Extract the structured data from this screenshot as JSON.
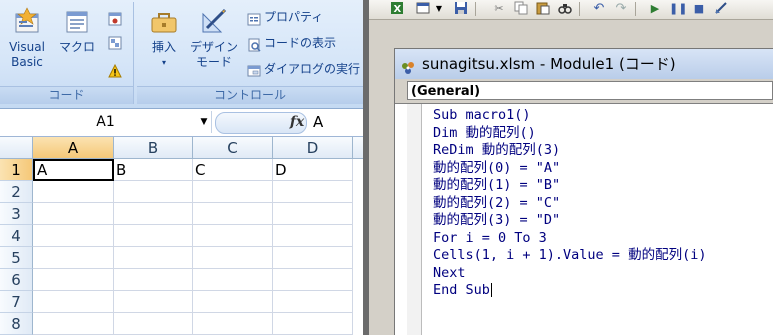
{
  "ribbon": {
    "code_group": {
      "label": "コード",
      "visual_basic": [
        "Visual",
        "Basic"
      ],
      "macro": "マクロ"
    },
    "controls_group": {
      "label": "コントロール",
      "insert": "挿入",
      "design_mode": [
        "デザイン",
        "モード"
      ],
      "properties": "プロパティ",
      "view_code": "コードの表示",
      "run_dialog": "ダイアログの実行"
    }
  },
  "formula_bar": {
    "name_box": "A1",
    "fx": "fx",
    "value": "A"
  },
  "sheet": {
    "columns": [
      "A",
      "B",
      "C",
      "D"
    ],
    "rows": [
      "1",
      "2",
      "3",
      "4",
      "5",
      "6",
      "7",
      "8"
    ],
    "cells": {
      "A1": "A",
      "B1": "B",
      "C1": "C",
      "D1": "D"
    }
  },
  "vbe": {
    "window_title": "sunagitsu.xlsm - Module1 (コード)",
    "object_combo": "(General)",
    "code": [
      "Sub macro1()",
      "Dim 動的配列()",
      "ReDim 動的配列(3)",
      "動的配列(0) = \"A\"",
      "動的配列(1) = \"B\"",
      "動的配列(2) = \"C\"",
      "動的配列(3) = \"D\"",
      "For i = 0 To 3",
      "Cells(1, i + 1).Value = 動的配列(i)",
      "Next",
      "End Sub"
    ]
  },
  "colors": {
    "ribbon_bg": "#d5e5f8",
    "group_label": "#3e6aa7",
    "selected_header": "#f5c878",
    "code_text": "#00007f"
  }
}
